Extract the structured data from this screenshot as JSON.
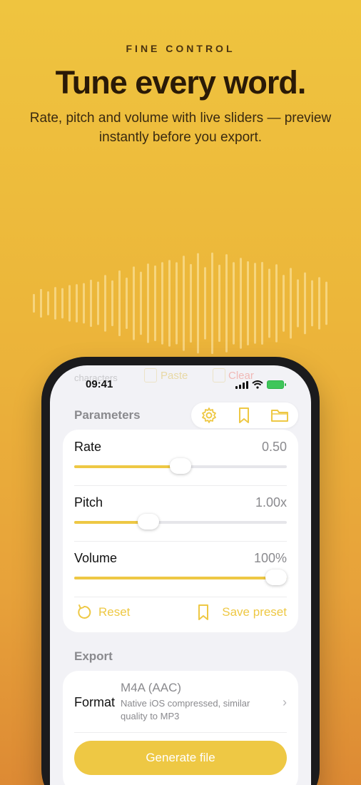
{
  "header": {
    "eyebrow": "FINE CONTROL",
    "headline": "Tune every word.",
    "subhead": "Rate, pitch and volume with live sliders — preview instantly before you export."
  },
  "phone": {
    "ghost": {
      "characters": "characters",
      "paste": "Paste",
      "clear": "Clear"
    },
    "status": {
      "time": "09:41"
    },
    "parameters": {
      "title": "Parameters",
      "toolbar_icons": [
        "gear-icon",
        "bookmark-icon",
        "folder-icon"
      ],
      "rate": {
        "label": "Rate",
        "value": "0.50",
        "fraction": 0.5
      },
      "pitch": {
        "label": "Pitch",
        "value": "1.00x",
        "fraction": 0.35
      },
      "volume": {
        "label": "Volume",
        "value": "100%",
        "fraction": 1.0
      },
      "reset_label": "Reset",
      "save_preset_label": "Save preset"
    },
    "export": {
      "title": "Export",
      "format_label": "Format",
      "format_value": "M4A (AAC)",
      "format_desc": "Native iOS compressed, similar quality to MP3",
      "generate_label": "Generate file"
    }
  },
  "colors": {
    "accent": "#eec844",
    "background_top": "#efc43f",
    "background_bottom": "#dd8a34"
  }
}
